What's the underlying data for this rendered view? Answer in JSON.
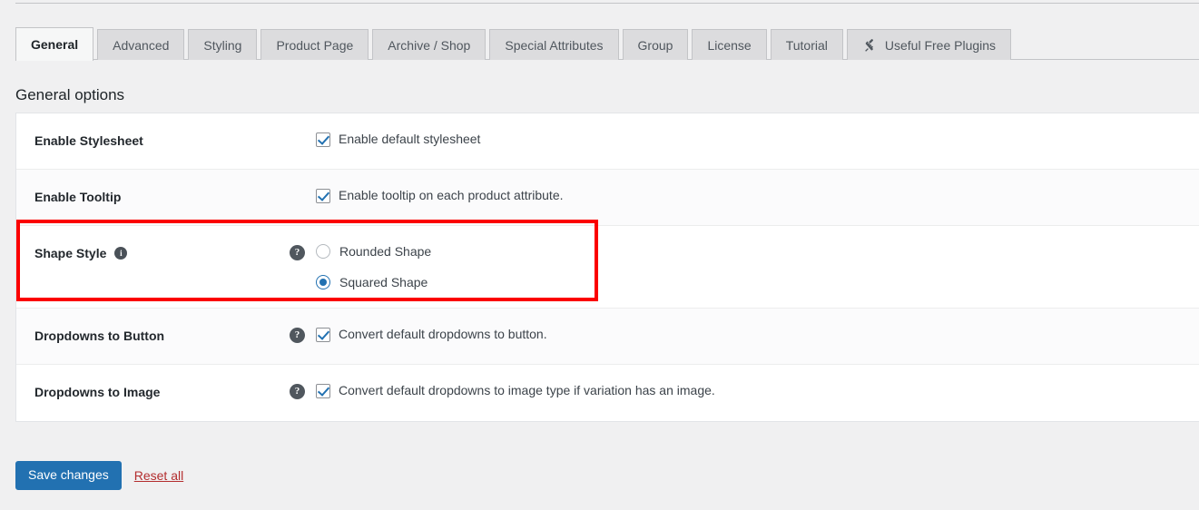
{
  "tabs": [
    {
      "label": "General",
      "active": true,
      "icon": null
    },
    {
      "label": "Advanced",
      "active": false,
      "icon": null
    },
    {
      "label": "Styling",
      "active": false,
      "icon": null
    },
    {
      "label": "Product Page",
      "active": false,
      "icon": null
    },
    {
      "label": "Archive / Shop",
      "active": false,
      "icon": null
    },
    {
      "label": "Special Attributes",
      "active": false,
      "icon": null
    },
    {
      "label": "Group",
      "active": false,
      "icon": null
    },
    {
      "label": "License",
      "active": false,
      "icon": null
    },
    {
      "label": "Tutorial",
      "active": false,
      "icon": null
    },
    {
      "label": "Useful Free Plugins",
      "active": false,
      "icon": "plug-icon"
    }
  ],
  "section": {
    "title": "General options"
  },
  "rows": [
    {
      "label": "Enable Stylesheet",
      "has_info_tip": false,
      "has_help_tip": false,
      "control": "checkbox",
      "checked": true,
      "option_text": "Enable default stylesheet"
    },
    {
      "label": "Enable Tooltip",
      "has_info_tip": false,
      "has_help_tip": false,
      "control": "checkbox",
      "checked": true,
      "option_text": "Enable tooltip on each product attribute."
    },
    {
      "label": "Shape Style",
      "has_info_tip": true,
      "has_help_tip": true,
      "control": "radio",
      "options": [
        {
          "text": "Rounded Shape",
          "selected": false
        },
        {
          "text": "Squared Shape",
          "selected": true
        }
      ]
    },
    {
      "label": "Dropdowns to Button",
      "has_info_tip": false,
      "has_help_tip": true,
      "control": "checkbox",
      "checked": true,
      "option_text": "Convert default dropdowns to button."
    },
    {
      "label": "Dropdowns to Image",
      "has_info_tip": false,
      "has_help_tip": true,
      "control": "checkbox",
      "checked": true,
      "option_text": "Convert default dropdowns to image type if variation has an image."
    }
  ],
  "icons": {
    "info_glyph": "i",
    "help_glyph": "?"
  },
  "footer": {
    "save_label": "Save changes",
    "reset_label": "Reset all"
  },
  "colors": {
    "accent": "#2271b1",
    "highlight": "#fb0000",
    "reset_link": "#b32d2e",
    "panel_bg": "#ffffff",
    "page_bg": "#f0f0f1"
  }
}
